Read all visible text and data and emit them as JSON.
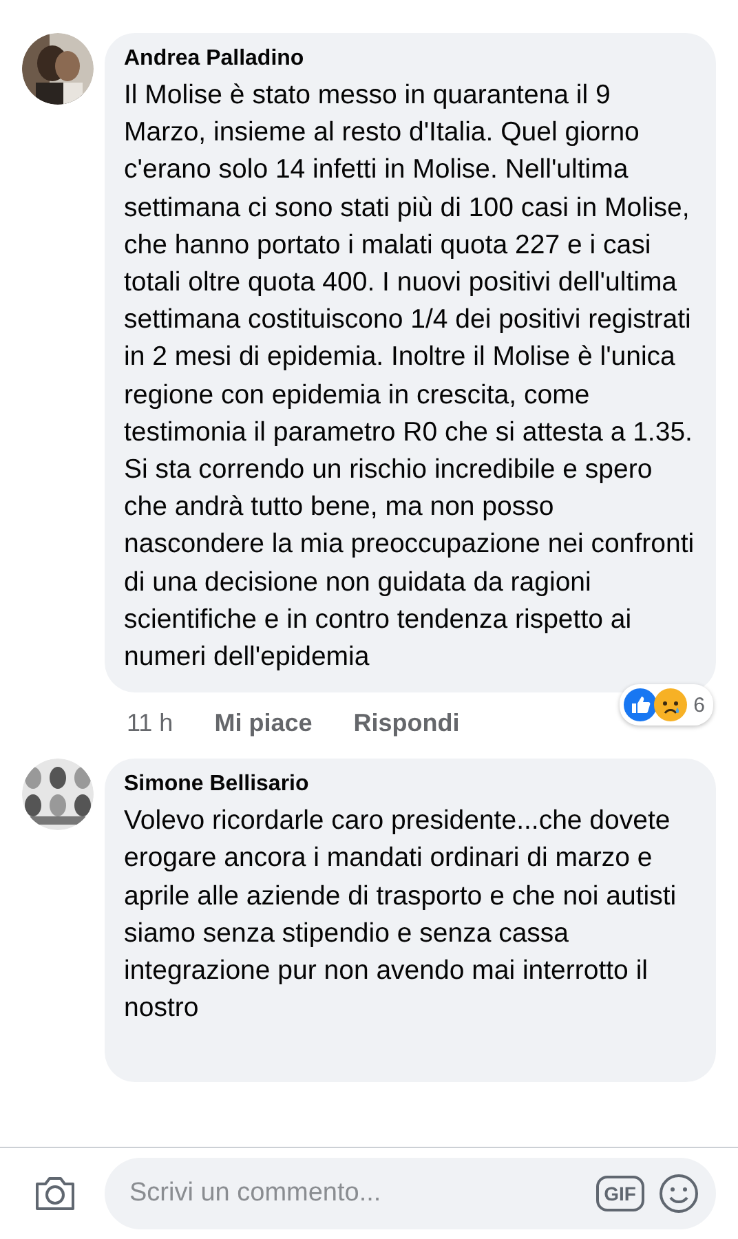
{
  "comments": [
    {
      "author": "Andrea Palladino",
      "text": "Il Molise è stato messo in quarantena il 9 Marzo, insieme al resto d'Italia. Quel giorno c'erano solo 14 infetti in Molise. Nell'ultima settimana ci sono stati più di 100 casi in Molise, che hanno portato i malati quota 227 e i casi totali oltre quota 400. I nuovi positivi dell'ultima settimana costituiscono 1/4 dei positivi registrati in 2 mesi di epidemia. Inoltre il Molise è l'unica regione con epidemia in crescita, come testimonia il parametro R0 che si attesta a 1.35. Si sta correndo un rischio incredibile e spero che andrà tutto bene, ma non posso nascondere la mia preoccupazione nei confronti di una decisione non guidata da ragioni scientifiche e in contro tendenza rispetto ai numeri dell'epidemia",
      "time": "11 h",
      "actions": [
        "Mi piace",
        "Rispondi"
      ],
      "reactions": {
        "count": "6"
      }
    },
    {
      "author": "Simone Bellisario",
      "text": "Volevo ricordarle caro presidente...che dovete erogare ancora i mandati ordinari di marzo e aprile alle aziende di trasporto e che noi autisti siamo senza stipendio e senza cassa integrazione pur non avendo mai interrotto il nostro"
    }
  ],
  "composer": {
    "placeholder": "Scrivi un commento...",
    "gif": "GIF"
  }
}
